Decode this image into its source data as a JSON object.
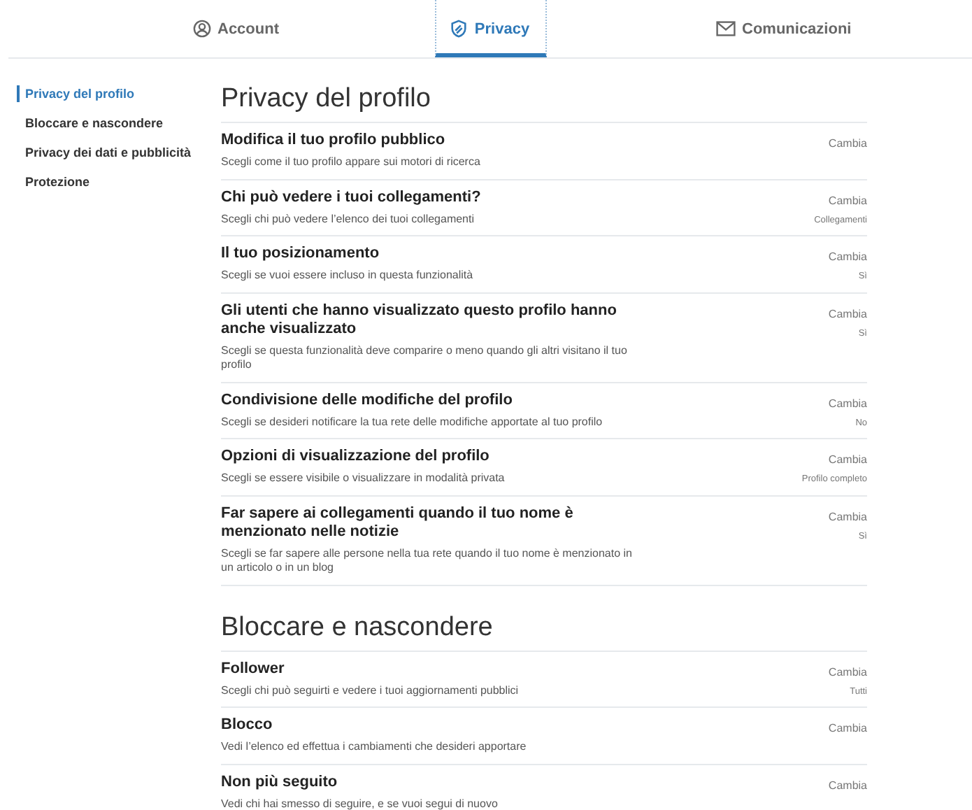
{
  "tabs": [
    {
      "label": "Account",
      "selected": false
    },
    {
      "label": "Privacy",
      "selected": true
    },
    {
      "label": "Comunicazioni",
      "selected": false
    }
  ],
  "sidebar": {
    "items": [
      {
        "label": "Privacy del profilo",
        "selected": true
      },
      {
        "label": "Bloccare e nascondere",
        "selected": false
      },
      {
        "label": "Privacy dei dati e pubblicità",
        "selected": false
      },
      {
        "label": "Protezione",
        "selected": false
      }
    ]
  },
  "sections": [
    {
      "title": "Privacy del profilo",
      "rows": [
        {
          "title": "Modifica il tuo profilo pubblico",
          "description": "Scegli come il tuo profilo appare sui motori di ricerca",
          "action": "Cambia"
        },
        {
          "title": "Chi può vedere i tuoi collegamenti?",
          "description": "Scegli chi può vedere l’elenco dei tuoi collegamenti",
          "action": "Cambia",
          "value": "Collegamenti"
        },
        {
          "title": "Il tuo posizionamento",
          "description": "Scegli se vuoi essere incluso in questa funzionalità",
          "action": "Cambia",
          "value": "Sì"
        },
        {
          "title": "Gli utenti che hanno visualizzato questo profilo hanno anche visualizzato",
          "description": "Scegli se questa funzionalità deve comparire o meno quando gli altri visitano il tuo profilo",
          "action": "Cambia",
          "value": "Sì"
        },
        {
          "title": "Condivisione delle modifiche del profilo",
          "description": "Scegli se desideri notificare la tua rete delle modifiche apportate al tuo profilo",
          "action": "Cambia",
          "value": "No"
        },
        {
          "title": "Opzioni di visualizzazione del profilo",
          "description": "Scegli se essere visibile o visualizzare in modalità privata",
          "action": "Cambia",
          "value": "Profilo completo"
        },
        {
          "title": "Far sapere ai collegamenti quando il tuo nome è menzionato nelle notizie",
          "description": "Scegli se far sapere alle persone nella tua rete quando il tuo nome è menzionato in un articolo o in un blog",
          "action": "Cambia",
          "value": "Sì"
        }
      ]
    },
    {
      "title": "Bloccare e nascondere",
      "rows": [
        {
          "title": "Follower",
          "description": "Scegli chi può seguirti e vedere i tuoi aggiornamenti pubblici",
          "action": "Cambia",
          "value": "Tutti"
        },
        {
          "title": "Blocco",
          "description": "Vedi l’elenco ed effettua i cambiamenti che desideri apportare",
          "action": "Cambia"
        },
        {
          "title": "Non più seguito",
          "description": "Vedi chi hai smesso di seguire, e se vuoi segui di nuovo",
          "action": "Cambia"
        }
      ]
    }
  ]
}
